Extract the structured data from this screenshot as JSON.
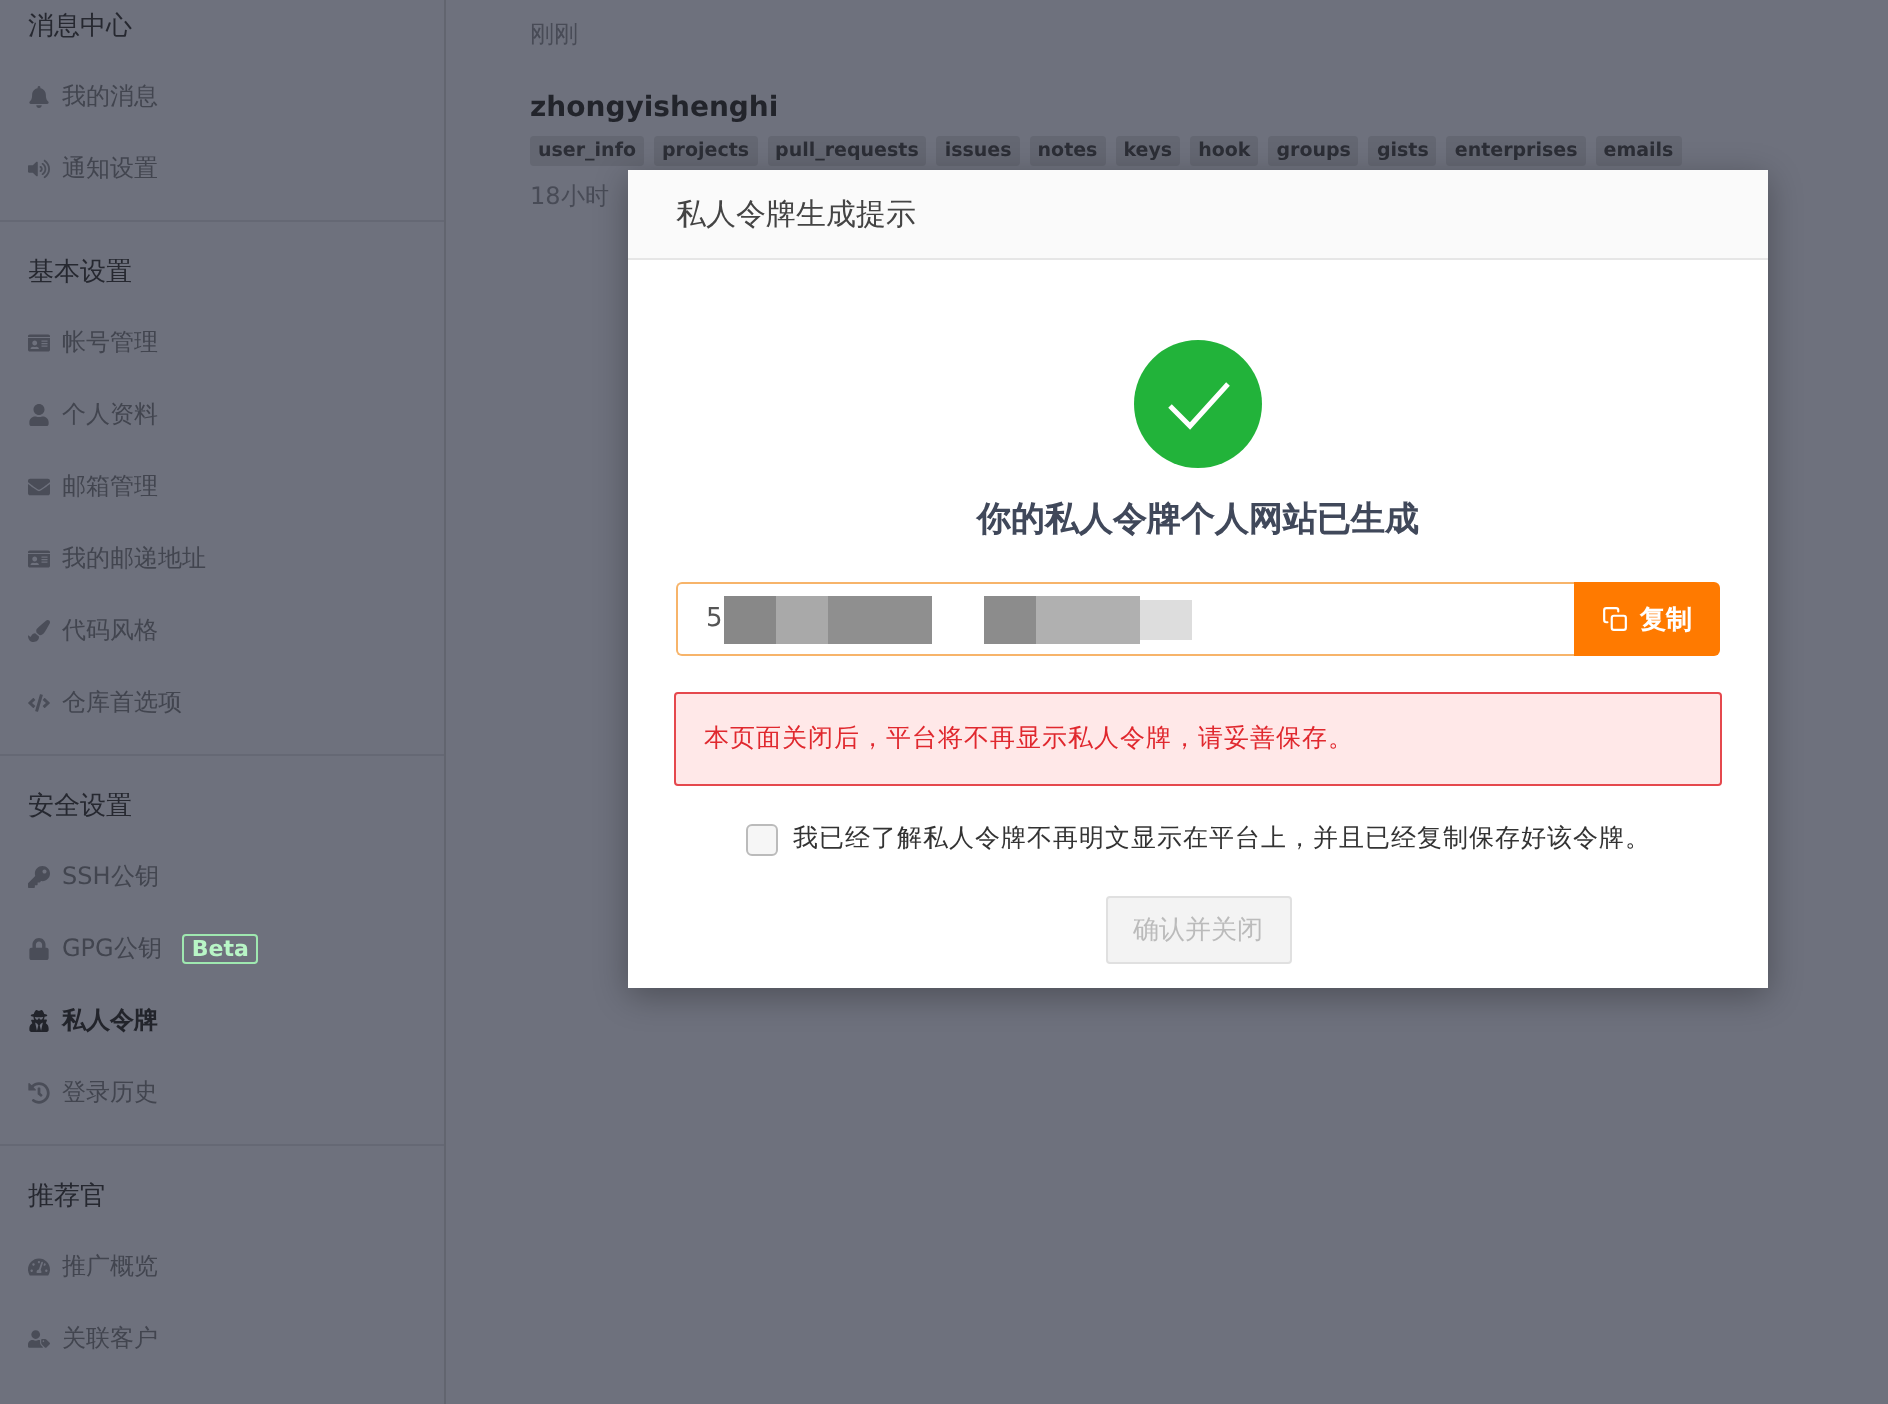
{
  "sidebar": {
    "sections": [
      {
        "title": "消息中心",
        "items": [
          {
            "label": "我的消息",
            "selected": false
          },
          {
            "label": "通知设置",
            "selected": false
          }
        ]
      },
      {
        "title": "基本设置",
        "items": [
          {
            "label": "帐号管理",
            "selected": false
          },
          {
            "label": "个人资料",
            "selected": false
          },
          {
            "label": "邮箱管理",
            "selected": false
          },
          {
            "label": "我的邮递地址",
            "selected": false
          },
          {
            "label": "代码风格",
            "selected": false
          },
          {
            "label": "仓库首选项",
            "selected": false
          }
        ]
      },
      {
        "title": "安全设置",
        "items": [
          {
            "label": "SSH公钥",
            "selected": false
          },
          {
            "label": "GPG公钥",
            "badge": "Beta",
            "selected": false
          },
          {
            "label": "私人令牌",
            "selected": true
          },
          {
            "label": "登录历史",
            "selected": false
          }
        ]
      },
      {
        "title": "推荐官",
        "items": [
          {
            "label": "推广概览",
            "selected": false
          },
          {
            "label": "关联客户",
            "selected": false
          }
        ]
      }
    ]
  },
  "main": {
    "first_time": "刚刚",
    "token_name": "zhongyishenghi",
    "scopes": [
      "user_info",
      "projects",
      "pull_requests",
      "issues",
      "notes",
      "keys",
      "hook",
      "groups",
      "gists",
      "enterprises",
      "emails"
    ],
    "second_time": "18小时"
  },
  "dialog": {
    "title": "私人令牌生成提示",
    "heading": "你的私人令牌个人网站已生成",
    "token": {
      "value": "5"
    },
    "copy_button": "复制",
    "warning": "本页面关闭后，平台将不再显示私人令牌，请妥善保存。",
    "confirmation": {
      "label": "我已经了解私人令牌不再明文显示在平台上，并且已经复制保存好该令牌。",
      "checked": false
    },
    "close_button": {
      "label": "确认并关闭",
      "disabled": true
    }
  }
}
